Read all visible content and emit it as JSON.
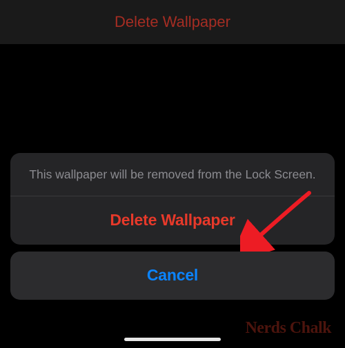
{
  "topbar": {
    "title": "Delete Wallpaper"
  },
  "sheet": {
    "message": "This wallpaper will be removed from the Lock Screen.",
    "destructive_label": "Delete Wallpaper",
    "cancel_label": "Cancel"
  },
  "watermark": "Nerds Chalk"
}
